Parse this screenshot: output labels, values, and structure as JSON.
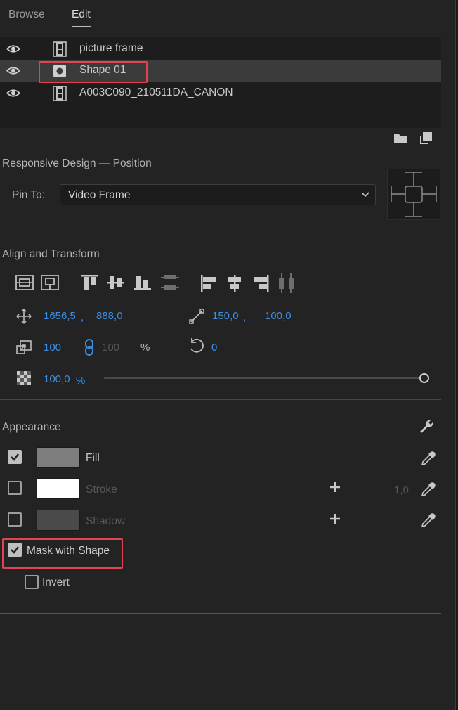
{
  "tabs": [
    {
      "label": "Browse"
    },
    {
      "label": "Edit"
    }
  ],
  "layers": [
    {
      "name": "picture frame",
      "type": "clip"
    },
    {
      "name": "Shape 01",
      "type": "shape",
      "selected": true
    },
    {
      "name": "A003C090_210511DA_CANON",
      "type": "clip"
    }
  ],
  "responsive": {
    "title": "Responsive Design — Position",
    "pin_label": "Pin To:",
    "pin_value": "Video Frame"
  },
  "align": {
    "title": "Align and Transform",
    "position_x": "1656,5",
    "position_y": "888,0",
    "sep": ",",
    "size_w": "150,0",
    "size_h": "100,0",
    "scale": "100",
    "scale_linked": "100",
    "scale_unit": "%",
    "rotation": "0",
    "opacity": "100,0",
    "opacity_unit": "%",
    "opacity_level": 1.0
  },
  "appearance": {
    "title": "Appearance",
    "fill": {
      "label": "Fill",
      "checked": true,
      "color": "#7d7d7d"
    },
    "stroke": {
      "label": "Stroke",
      "checked": false,
      "color": "#ffffff",
      "width": "1,0"
    },
    "shadow": {
      "label": "Shadow",
      "checked": false,
      "color": "#4a4a4a"
    },
    "mask": {
      "label": "Mask with Shape",
      "checked": true
    },
    "invert": {
      "label": "Invert",
      "checked": false
    }
  },
  "colors": {
    "accent": "#3b8ee0",
    "highlight": "#e0454f",
    "panel": "#232323"
  }
}
